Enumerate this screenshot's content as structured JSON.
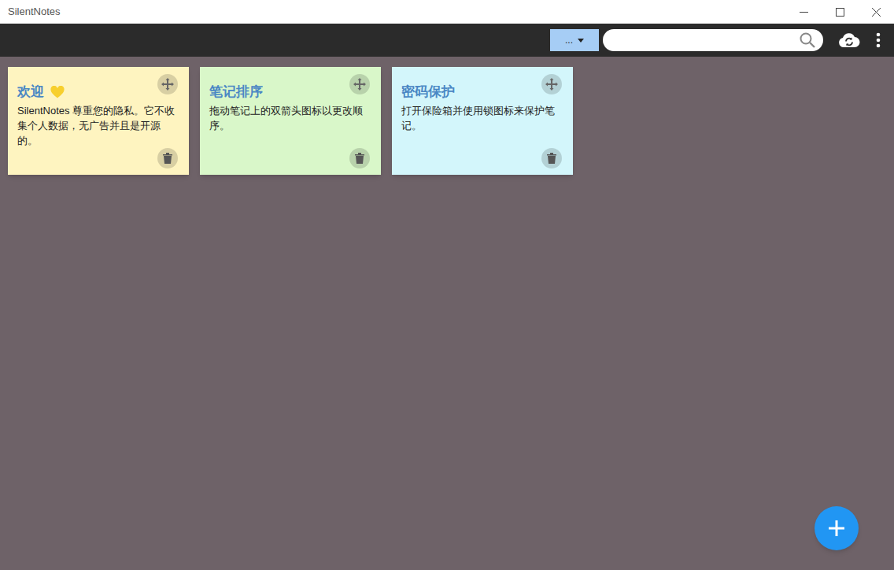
{
  "window": {
    "title": "SilentNotes"
  },
  "toolbar": {
    "dropdown": {
      "label": "..."
    }
  },
  "search": {
    "placeholder": ""
  },
  "notes": [
    {
      "title": "欢迎",
      "body": "SilentNotes 尊重您的隐私。它不收集个人数据，无广告并且是开源的。",
      "color": "#fef4c0"
    },
    {
      "title": "笔记排序",
      "body": "拖动笔记上的双箭头图标以更改顺序。",
      "color": "#d9f7c9"
    },
    {
      "title": "密码保护",
      "body": "打开保险箱并使用锁图标来保护笔记。",
      "color": "#d3f6fb"
    }
  ]
}
